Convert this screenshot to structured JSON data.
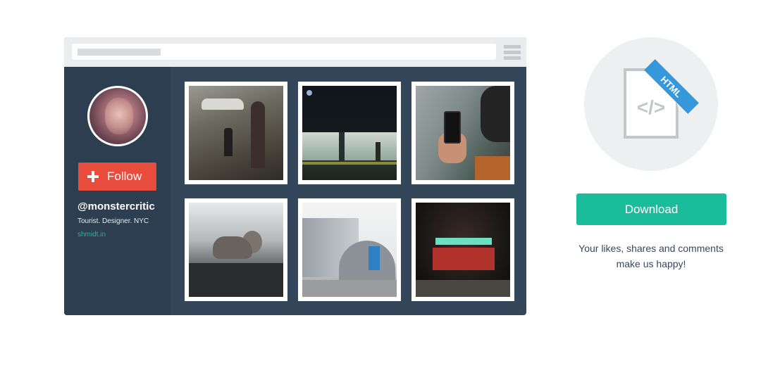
{
  "profile": {
    "follow_label": "Follow",
    "username": "@monstercritic",
    "bio": "Tourist. Designer. NYC",
    "website": "shmidt.in"
  },
  "download": {
    "button_label": "Download",
    "file_badge": "HTML",
    "code_glyph": "</>",
    "tagline": "Your likes, shares and comments make us happy!"
  },
  "colors": {
    "follow_button": "#e74c3c",
    "download_button": "#1abc9c",
    "sidebar": "#2d3e50",
    "content": "#344659",
    "badge": "#3498db"
  },
  "icons": [
    "plus-icon",
    "menu-icon",
    "html-file-icon"
  ]
}
